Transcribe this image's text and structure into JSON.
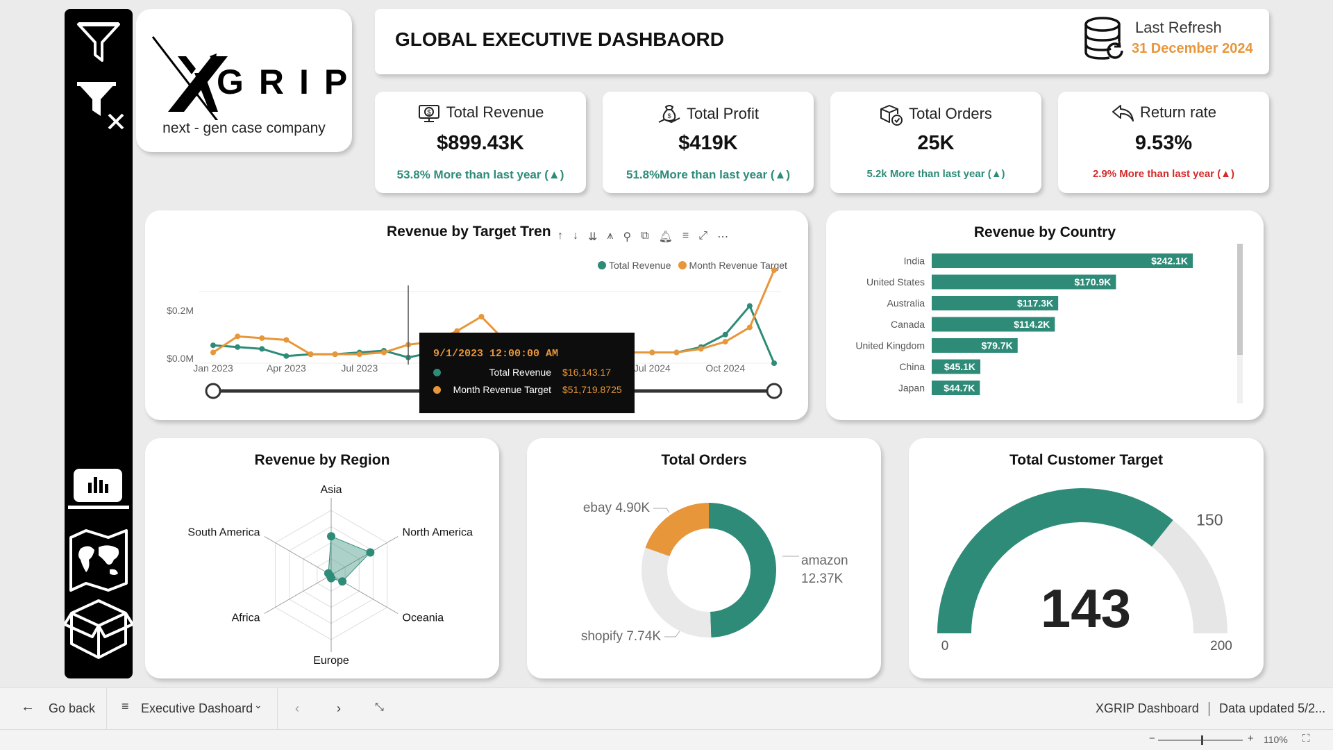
{
  "header": {
    "title": "GLOBAL EXECUTIVE DASHBAORD",
    "refresh_label": "Last Refresh",
    "refresh_date": "31 December 2024"
  },
  "logo": {
    "brand": "XGRIP",
    "tagline": "next - gen case company"
  },
  "sidebar": {
    "icons": [
      "filter-icon",
      "clear-filter-icon",
      "bar-chart-icon",
      "world-map-icon",
      "box-icon"
    ]
  },
  "kpis": [
    {
      "title": "Total Revenue",
      "value": "$899.43K",
      "delta": "53.8% More than last year (▲)",
      "delta_color": "#2e8b78",
      "icon": "revenue-icon"
    },
    {
      "title": "Total Profit",
      "value": "$419K",
      "delta": "51.8%More than last year (▲)",
      "delta_color": "#2e8b78",
      "icon": "profit-icon"
    },
    {
      "title": "Total Orders",
      "value": "25K",
      "delta": "5.2k More than last year (▲)",
      "delta_color": "#2e8b78",
      "icon": "orders-icon"
    },
    {
      "title": "Return rate",
      "value": "9.53%",
      "delta": "2.9% More than last year (▲)",
      "delta_color": "#d42a2a",
      "icon": "return-icon"
    }
  ],
  "trend": {
    "title": "Revenue by Target Tren",
    "legend": [
      "Total Revenue",
      "Month Revenue Target"
    ],
    "y_ticks": [
      "$0.2M",
      "$0.0M"
    ],
    "x_ticks": [
      "Jan 2023",
      "Apr 2023",
      "Jul 2023",
      "O",
      "Jul 2024",
      "Oct 2024"
    ],
    "tooltip": {
      "date": "9/1/2023 12:00:00 AM",
      "rows": [
        {
          "label": "Total Revenue",
          "value": "$16,143.17"
        },
        {
          "label": "Month Revenue Target",
          "value": "$51,719.8725"
        }
      ]
    }
  },
  "country": {
    "title": "Revenue by Country"
  },
  "region": {
    "title": "Revenue by Region"
  },
  "orders": {
    "title": "Total Orders",
    "labels": {
      "ebay": "ebay 4.90K",
      "amazon_1": "amazon",
      "amazon_2": "12.37K",
      "shopify": "shopify 7.74K"
    }
  },
  "gauge": {
    "title": "Total Customer Target",
    "value_label": "143",
    "min_label": "0",
    "max_label": "200",
    "target_label": "150"
  },
  "footer": {
    "go_back": "Go back",
    "page_name": "Executive Dashoard",
    "report_name": "XGRIP Dashboard",
    "data_updated": "Data updated 5/2...",
    "zoom": "110%"
  },
  "colors": {
    "teal": "#2e8b78",
    "orange": "#e8963a",
    "red": "#d42a2a"
  },
  "chart_data": [
    {
      "type": "line",
      "title": "Revenue by Target Tren",
      "x": [
        "Jan 2023",
        "Feb 2023",
        "Mar 2023",
        "Apr 2023",
        "May 2023",
        "Jun 2023",
        "Jul 2023",
        "Aug 2023",
        "Sep 2023",
        "Oct 2023",
        "Nov 2023",
        "Dec 2023",
        "Jan 2024",
        "Feb 2024",
        "Mar 2024",
        "Apr 2024",
        "May 2024",
        "Jun 2024",
        "Jul 2024",
        "Aug 2024",
        "Sep 2024",
        "Oct 2024",
        "Nov 2024",
        "Dec 2024"
      ],
      "series": [
        {
          "name": "Total Revenue",
          "values": [
            0.05,
            0.045,
            0.04,
            0.02,
            0.025,
            0.025,
            0.03,
            0.035,
            0.016,
            0.03,
            0.035,
            0.04,
            0.04,
            0.045,
            0.035,
            0.03,
            0.03,
            0.03,
            0.03,
            0.03,
            0.045,
            0.08,
            0.16,
            0.0
          ]
        },
        {
          "name": "Month Revenue Target",
          "values": [
            0.03,
            0.075,
            0.07,
            0.065,
            0.025,
            0.025,
            0.025,
            0.03,
            0.0517,
            0.06,
            0.09,
            0.13,
            0.06,
            0.04,
            0.035,
            0.03,
            0.03,
            0.03,
            0.03,
            0.03,
            0.04,
            0.06,
            0.1,
            0.26
          ]
        }
      ],
      "ylim": [
        0,
        0.26
      ],
      "legend": "top-right",
      "grid": true
    },
    {
      "type": "bar",
      "title": "Revenue by Country",
      "categories": [
        "India",
        "United States",
        "Australia",
        "Canada",
        "United Kingdom",
        "China",
        "Japan"
      ],
      "values": [
        242.1,
        170.9,
        117.3,
        114.2,
        79.7,
        45.1,
        44.7
      ],
      "value_labels": [
        "$242.1K",
        "$170.9K",
        "$117.3K",
        "$114.2K",
        "$79.7K",
        "$45.1K",
        "$44.7K"
      ],
      "orientation": "horizontal",
      "xlim": [
        0,
        242.1
      ]
    },
    {
      "type": "radar",
      "title": "Revenue by Region",
      "categories": [
        "Asia",
        "North America",
        "Oceania",
        "Europe",
        "Africa",
        "South America"
      ],
      "values": [
        0.6,
        0.7,
        0.2,
        0.05,
        0.02,
        0.05
      ],
      "rlim": [
        0,
        1
      ]
    },
    {
      "type": "pie",
      "title": "Total Orders",
      "categories": [
        "amazon",
        "shopify",
        "ebay"
      ],
      "values": [
        12.37,
        7.74,
        4.9
      ],
      "donut": true
    },
    {
      "type": "gauge",
      "title": "Total Customer Target",
      "value": 143,
      "min": 0,
      "max": 200,
      "target": 150
    }
  ]
}
